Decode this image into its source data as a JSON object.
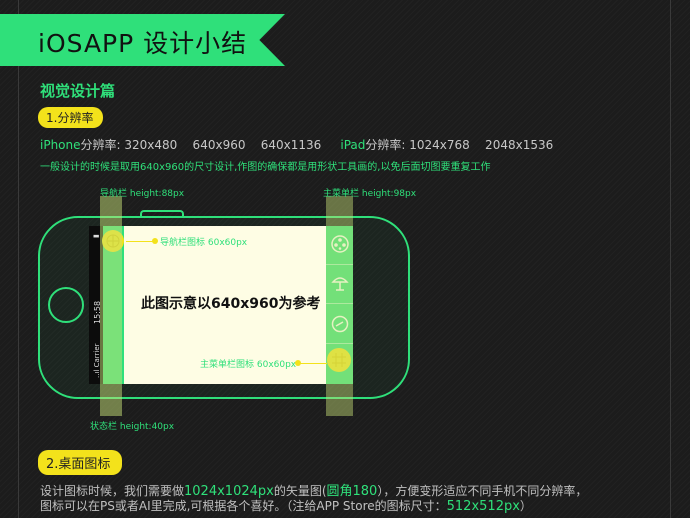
{
  "banner": {
    "title": "iOSAPP 设计小结"
  },
  "section": {
    "title": "视觉设计篇"
  },
  "step1": {
    "label": "1.分辨率"
  },
  "resolution": {
    "iphone_label": "iPhone",
    "iphone_suffix": "分辨率:",
    "iphone_values": "320x480    640x960    640x1136",
    "ipad_label": "iPad",
    "ipad_suffix": "分辨率:",
    "ipad_values": "1024x768    2048x1536"
  },
  "note": {
    "text": "一般设计的时候是取用640x960的尺寸设计,作图的确保都是用形状工具画的,以免后面切图要重复工作"
  },
  "diagram": {
    "nav_bar_label": "导航栏 height:88px",
    "tab_bar_label": "主菜单栏 height:98px",
    "nav_icon_label": "导航栏图标 60x60px",
    "tab_icon_label": "主菜单栏图标 60x60px",
    "status_bar_label": "状态栏 height:40px",
    "screen_caption": "此图示意以640x960为参考",
    "status_time": "15:58",
    "status_carrier": "..ıl Carrier"
  },
  "step2": {
    "label": "2.桌面图标"
  },
  "description": {
    "line1_a": "设计图标时候，我们需要做",
    "line1_b": "1024x1024px",
    "line1_c": "的矢量图(",
    "line1_d": "圆角180",
    "line1_e": "），方便变形适应不同手机不同分辨率，",
    "line2_a": "图标可以在PS或者AI里完成,可根据各个喜好。（注给APP Store的图标尺寸：",
    "line2_b": "512x512px",
    "line2_c": "）"
  },
  "colors": {
    "accent": "#2fe07a",
    "highlight": "#f3e21b",
    "background": "#1c1c1c",
    "screen": "#fefde4"
  }
}
